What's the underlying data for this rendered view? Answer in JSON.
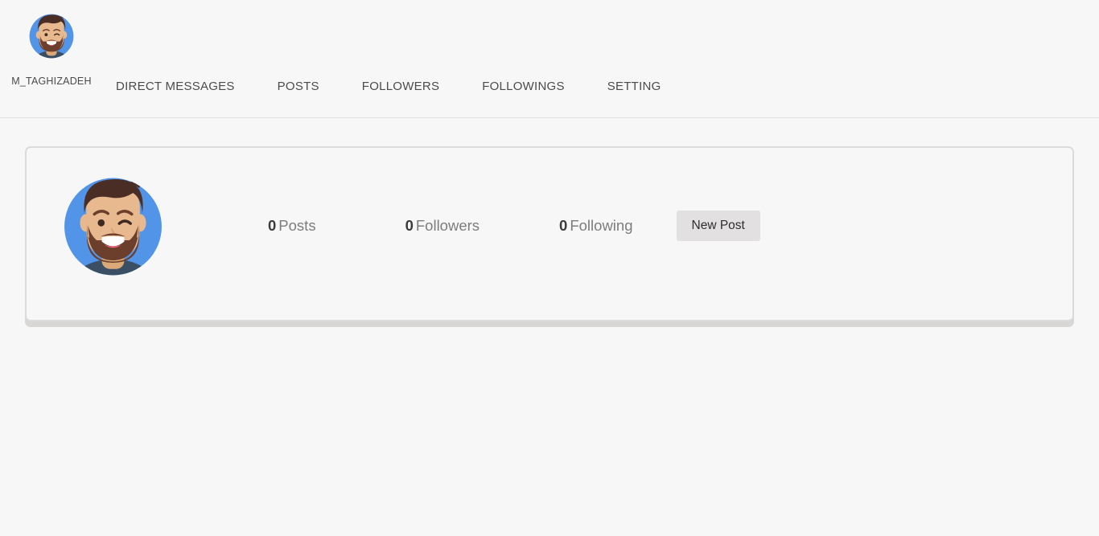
{
  "header": {
    "username": "M_TAGHIZADEH",
    "avatar_icon": "user-avatar-bearded-man",
    "nav": [
      {
        "label": "DIRECT MESSAGES",
        "name": "nav-direct-messages"
      },
      {
        "label": "POSTS",
        "name": "nav-posts"
      },
      {
        "label": "FOLLOWERS",
        "name": "nav-followers"
      },
      {
        "label": "FOLLOWINGS",
        "name": "nav-followings"
      },
      {
        "label": "SETTING",
        "name": "nav-setting"
      }
    ]
  },
  "profile": {
    "avatar_icon": "profile-avatar-bearded-man",
    "stats": {
      "posts_count": "0",
      "posts_label": "Posts",
      "followers_count": "0",
      "followers_label": "Followers",
      "following_count": "0",
      "following_label": "Following"
    },
    "new_post_label": "New Post"
  },
  "colors": {
    "page_background": "#f7f7f7",
    "avatar_blue": "#5294e8",
    "avatar_skin": "#e8b88f",
    "avatar_hair": "#4a2e26",
    "avatar_shirt": "#3a4f63",
    "card_border": "#dcdada",
    "card_shadow": "#d9d6d6",
    "button_background": "#e2e0e0",
    "nav_text": "#4b4b4b",
    "stat_number": "#3c3c3c",
    "stat_label": "#7d7d7d"
  }
}
